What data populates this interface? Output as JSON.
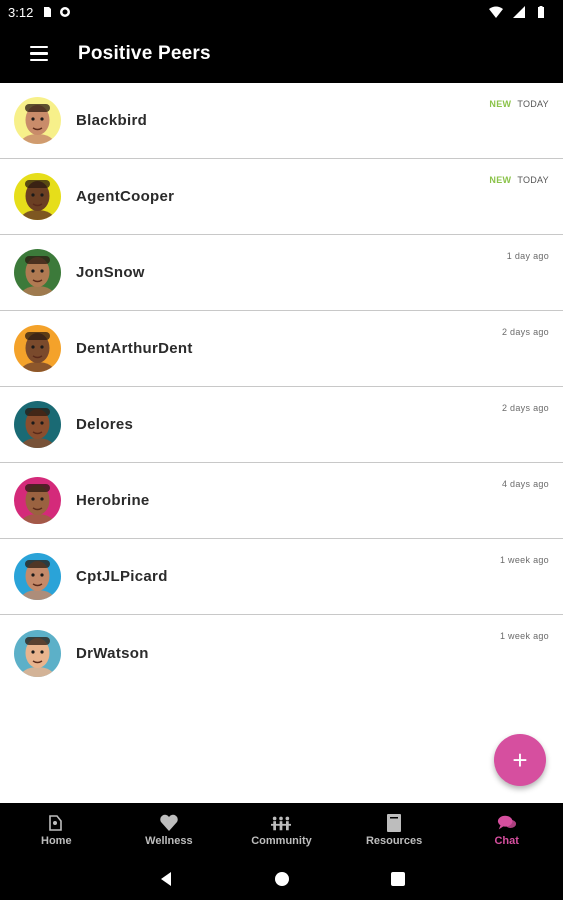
{
  "status_bar": {
    "time": "3:12"
  },
  "app_bar": {
    "title": "Positive Peers"
  },
  "chats": [
    {
      "name": "Blackbird",
      "new_label": "NEW",
      "time": "TODAY",
      "avatar_bg": "#f7f08a",
      "skin": "#c98c6a"
    },
    {
      "name": "AgentCooper",
      "new_label": "NEW",
      "time": "TODAY",
      "avatar_bg": "#e6de1a",
      "skin": "#6b3f23"
    },
    {
      "name": "JonSnow",
      "new_label": "",
      "time": "1 day ago",
      "avatar_bg": "#3c7a3a",
      "skin": "#b07a52"
    },
    {
      "name": "DentArthurDent",
      "new_label": "",
      "time": "2 days ago",
      "avatar_bg": "#f4a22a",
      "skin": "#7a4a2c"
    },
    {
      "name": "Delores",
      "new_label": "",
      "time": "2 days ago",
      "avatar_bg": "#1a6a74",
      "skin": "#8a4e2e"
    },
    {
      "name": "Herobrine",
      "new_label": "",
      "time": "4 days ago",
      "avatar_bg": "#d42a7a",
      "skin": "#9a6240"
    },
    {
      "name": "CptJLPicard",
      "new_label": "",
      "time": "1 week ago",
      "avatar_bg": "#2aa3d8",
      "skin": "#c48a6a"
    },
    {
      "name": "DrWatson",
      "new_label": "",
      "time": "1 week ago",
      "avatar_bg": "#5cb0c8",
      "skin": "#e8b48e"
    }
  ],
  "fab": {
    "label": "+"
  },
  "bottom_nav": {
    "items": [
      {
        "label": "Home",
        "icon": "home-icon"
      },
      {
        "label": "Wellness",
        "icon": "heart-icon"
      },
      {
        "label": "Community",
        "icon": "community-icon"
      },
      {
        "label": "Resources",
        "icon": "book-icon"
      },
      {
        "label": "Chat",
        "icon": "chat-icon"
      }
    ],
    "active": "Chat"
  },
  "colors": {
    "accent": "#d64f9f",
    "new_badge": "#8bc34a",
    "bar_bg": "#000000"
  }
}
